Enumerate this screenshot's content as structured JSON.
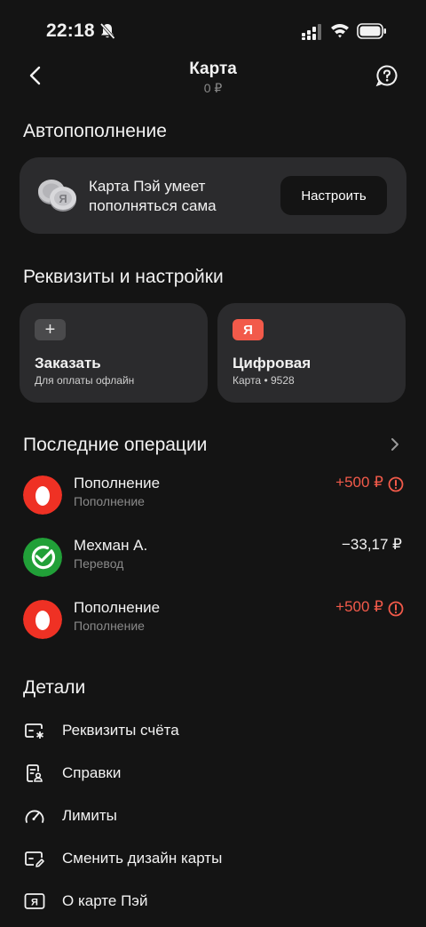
{
  "status_bar": {
    "time": "22:18"
  },
  "header": {
    "title": "Карта",
    "balance": "0 ₽"
  },
  "autopay": {
    "section_title": "Автопополнение",
    "text": "Карта Пэй умеет пополняться сама",
    "button_label": "Настроить"
  },
  "requisites": {
    "section_title": "Реквизиты и настройки",
    "order": {
      "badge": "+",
      "title": "Заказать",
      "subtitle": "Для оплаты офлайн"
    },
    "digital": {
      "badge": "Я",
      "title": "Цифровая",
      "subtitle": "Карта • 9528"
    }
  },
  "operations": {
    "section_title": "Последние операции",
    "items": [
      {
        "title": "Пополнение",
        "subtitle": "Пополнение",
        "amount": "+500 ₽",
        "icon": "alfa-bank-icon",
        "status": "alert"
      },
      {
        "title": "Мехман А.",
        "subtitle": "Перевод",
        "amount": "−33,17 ₽",
        "icon": "sber-icon",
        "status": "ok"
      },
      {
        "title": "Пополнение",
        "subtitle": "Пополнение",
        "amount": "+500 ₽",
        "icon": "alfa-bank-icon",
        "status": "alert"
      }
    ]
  },
  "details": {
    "section_title": "Детали",
    "items": [
      {
        "label": "Реквизиты счёта",
        "icon": "account-details-icon"
      },
      {
        "label": "Справки",
        "icon": "certificates-icon"
      },
      {
        "label": "Лимиты",
        "icon": "gauge-icon"
      },
      {
        "label": "Сменить дизайн карты",
        "icon": "card-design-icon"
      },
      {
        "label": "О карте Пэй",
        "icon": "ya-card-icon"
      }
    ]
  },
  "colors": {
    "background": "#141414",
    "card": "#2b2b2d",
    "accent_red": "#f25a4a",
    "sber_green": "#21a038",
    "alfa_red": "#ef3124"
  }
}
